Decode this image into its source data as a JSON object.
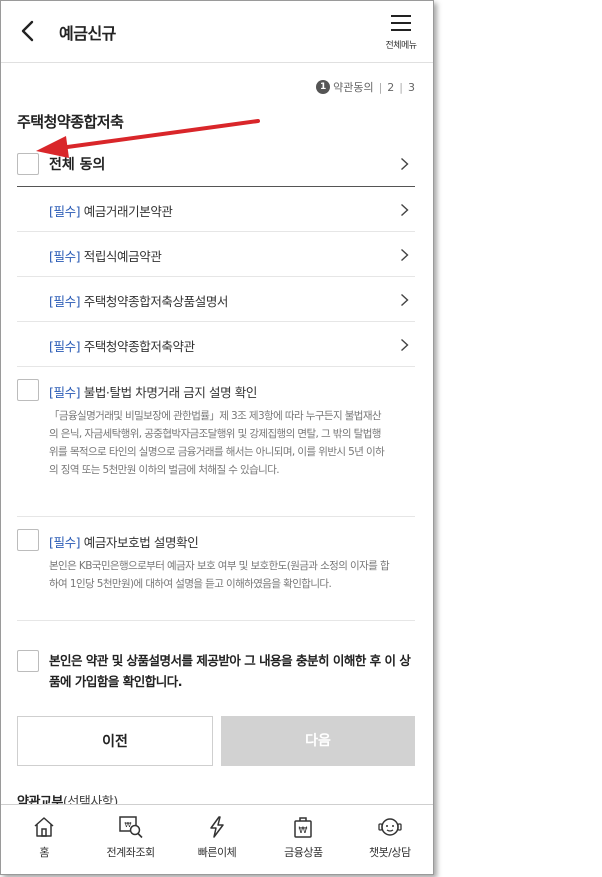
{
  "header": {
    "title": "예금신규",
    "menu_label": "전체메뉴"
  },
  "steps": {
    "current": "1",
    "current_label": "약관동의",
    "step2": "2",
    "step3": "3"
  },
  "product_title": "주택청약종합저축",
  "agree_all": {
    "label": "전체 동의"
  },
  "required_tag": "[필수]",
  "terms": [
    {
      "label": "예금거래기본약관"
    },
    {
      "label": "적립식예금약관"
    },
    {
      "label": "주택청약종합저축상품설명서"
    },
    {
      "label": "주택청약종합저축약관"
    }
  ],
  "notice1": {
    "label": "불법·탈법 차명거래 금지 설명 확인",
    "desc": "「금융실명거래및 비밀보장에 관한법률」제 3조 제3항에 따라 누구든지 불법재산의 은닉, 자금세탁행위, 공중협박자금조달행위 및 강제집행의 면탈, 그 밖의 탈법행위를 목적으로 타인의 실명으로 금융거래를 해서는 아니되며, 이를 위반시 5년 이하의 징역 또는 5천만원 이하의 벌금에 처해질 수 있습니다."
  },
  "notice2": {
    "label": "예금자보호법 설명확인",
    "desc": "본인은 KB국민은행으로부터 예금자 보호 여부 및 보호한도(원금과 소정의 이자를 합하여 1인당 5천만원)에 대하여 설명을 듣고 이해하였음을 확인합니다."
  },
  "confirm_text": "본인은 약관 및 상품설명서를 제공받아 그 내용을 충분히 이해한 후 이 상품에 가입함을 확인합니다.",
  "buttons": {
    "prev": "이전",
    "next": "다음"
  },
  "delivery": {
    "label": "약관교부",
    "optional": "(선택사항)"
  },
  "bottom_nav": [
    {
      "label": "홈",
      "icon": "home-icon"
    },
    {
      "label": "전계좌조회",
      "icon": "account-search-icon"
    },
    {
      "label": "빠른이체",
      "icon": "lightning-icon"
    },
    {
      "label": "금융상품",
      "icon": "won-bag-icon"
    },
    {
      "label": "챗봇/상담",
      "icon": "chatbot-icon"
    }
  ],
  "colors": {
    "required_tag": "#2a5bb5",
    "annotation_arrow": "#d9262a",
    "next_button_disabled": "#d2d2d2"
  }
}
